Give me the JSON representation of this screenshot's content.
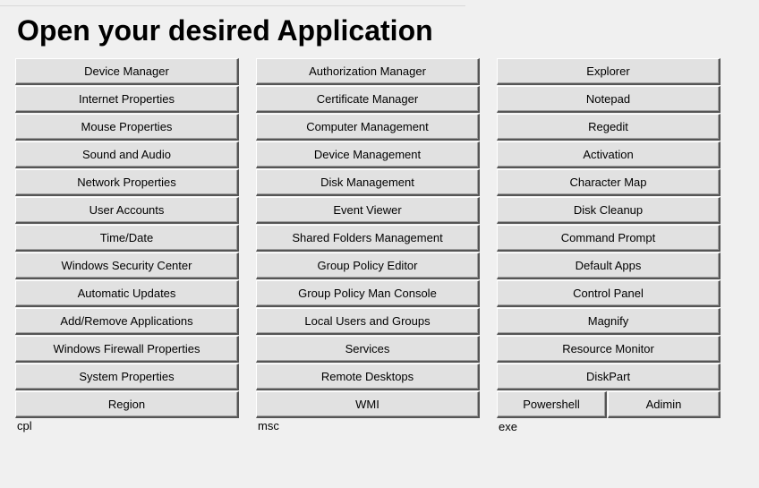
{
  "title": "Open your desired Application",
  "columns": {
    "cpl": {
      "label": "cpl",
      "buttons": [
        "Device Manager",
        "Internet Properties",
        "Mouse Properties",
        "Sound and Audio",
        "Network Properties",
        "User Accounts",
        "Time/Date",
        "Windows Security Center",
        "Automatic Updates",
        "Add/Remove Applications",
        "Windows Firewall Properties",
        "System Properties",
        "Region"
      ]
    },
    "msc": {
      "label": "msc",
      "buttons": [
        "Authorization Manager",
        "Certificate Manager",
        "Computer Management",
        "Device Management",
        "Disk Management",
        "Event Viewer",
        "Shared Folders Management",
        "Group Policy Editor",
        "Group Policy Man Console",
        "Local Users and Groups",
        "Services",
        "Remote Desktops",
        "WMI"
      ]
    },
    "exe": {
      "label": "exe",
      "buttons": [
        "Explorer",
        "Notepad",
        "Regedit",
        "Activation",
        "Character Map",
        "Disk Cleanup",
        "Command Prompt",
        "Default Apps",
        "Control Panel",
        "Magnify",
        "Resource Monitor",
        "DiskPart"
      ],
      "split_buttons": [
        "Powershell",
        "Adimin"
      ]
    }
  }
}
